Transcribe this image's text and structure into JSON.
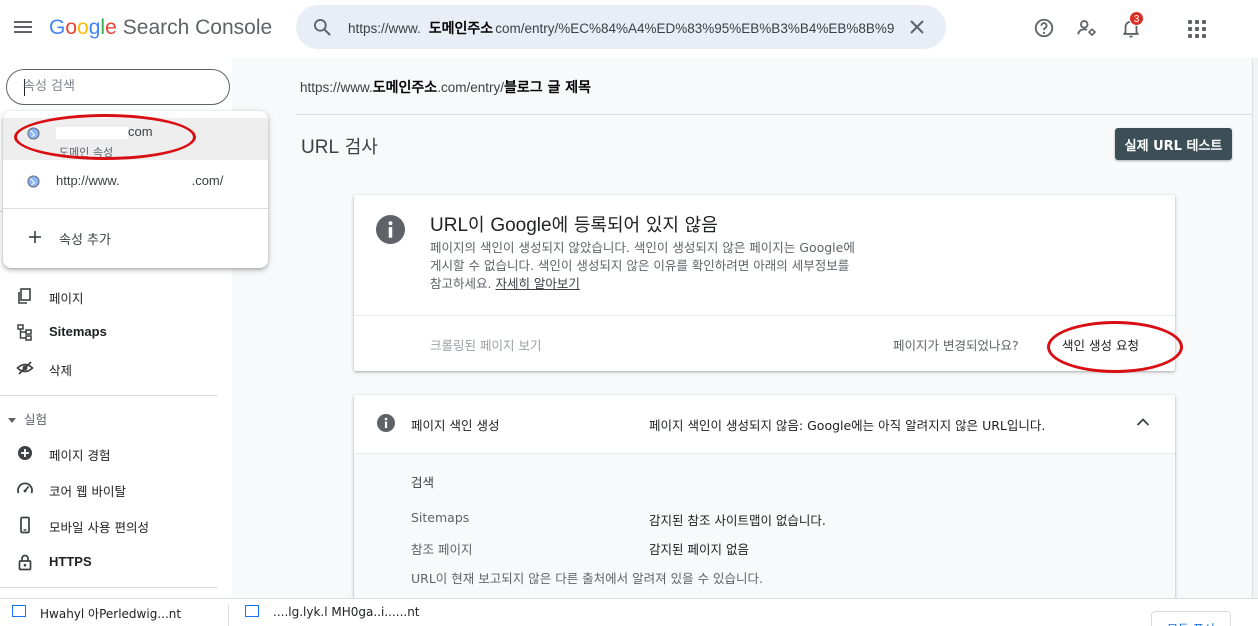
{
  "header": {
    "logo_google": [
      "G",
      "o",
      "o",
      "g",
      "l",
      "e"
    ],
    "logo_product": "Search Console",
    "search_url_prefix": "https://www.",
    "search_url_domain": "도메인주소",
    "search_url_suffix": "com/entry/%EC%84%A4%ED%83%95%EB%B3%B4%EB%8B%9",
    "notification_count": "3"
  },
  "sidebar": {
    "property_search_placeholder": "속성 검색",
    "properties": [
      {
        "name_suffix": "com",
        "type": "도메인 속성"
      },
      {
        "name_prefix": "http://www.",
        "name_suffix": ".com/"
      }
    ],
    "add_property": "속성 추가",
    "nav": [
      {
        "label": "페이지",
        "icon": "pages-icon"
      },
      {
        "label": "Sitemaps",
        "icon": "sitemap-icon"
      },
      {
        "label": "삭제",
        "icon": "removals-icon"
      }
    ],
    "section_experience": "실험",
    "experience_nav": [
      {
        "label": "페이지 경험",
        "icon": "page-experience-icon"
      },
      {
        "label": "코어 웹 바이탈",
        "icon": "speed-gauge-icon"
      },
      {
        "label": "모바일 사용 편의성",
        "icon": "mobile-icon"
      },
      {
        "label": "HTTPS",
        "icon": "lock-icon"
      }
    ]
  },
  "main": {
    "breadcrumb_prefix": "https://www.",
    "breadcrumb_domain": "도메인주소",
    "breadcrumb_mid": ".com/entry/",
    "breadcrumb_title": "블로그 글 제목",
    "page_title_en": "URL",
    "page_title_ko": " 검사",
    "live_test_label": "실제 URL 테스트",
    "status_card": {
      "title_en1": "URL",
      "title_ko1": "이 ",
      "title_en2": "Google",
      "title_ko2": "에 등록되어 있지 않음",
      "desc_line1": "페이지의 색인이 생성되지 않았습니다. 색인이 생성되지 않은 페이지는 Google에",
      "desc_line2": "게시할 수 없습니다. 색인이 생성되지 않은 이유를 확인하려면 아래의 세부정보를",
      "desc_line3": "참고하세요. ",
      "learn_more": "자세히 알아보기",
      "crawled_page": "크롤링된 페이지 보기",
      "changed_question": "페이지가 변경되었나요?",
      "request_indexing": "색인 생성 요청"
    },
    "index_card": {
      "label": "페이지 색인 생성",
      "status": "페이지 색인이 생성되지 않음: Google에는 아직 알려지지 않은 URL입니다.",
      "section_title": "검색",
      "rows": [
        {
          "key": "Sitemaps",
          "value": "감지된 참조 사이트맵이 없습니다."
        },
        {
          "key": "참조 페이지",
          "value": "감지된 페이지 없음"
        }
      ],
      "note": "URL이 현재 보고되지 않은 다른 출처에서 알려져 있을 수 있습니다."
    }
  },
  "download_bar": {
    "items": [
      "Hwahyl 아Perledwig...nt",
      "....lg.lyk.l MH0ga..i......nt"
    ],
    "show_all": "모두 표시"
  },
  "colors": {
    "accent_blue": "#1a73e8",
    "annotation_red": "#d80e12",
    "live_test_bg": "#3c4f56",
    "badge_red": "#d93025"
  }
}
